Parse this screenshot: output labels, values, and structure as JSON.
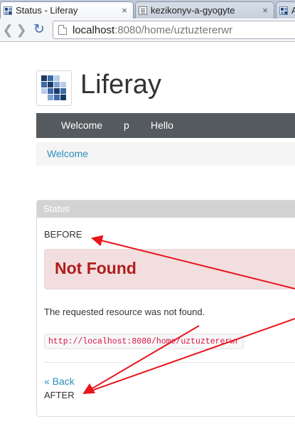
{
  "browser": {
    "tabs": [
      {
        "title": "Status - Liferay",
        "active": true
      },
      {
        "title": "kezikonyv-a-gyogyte",
        "active": false
      },
      {
        "title": "A",
        "active": false
      }
    ],
    "close_glyph": "×",
    "url_host": "localhost",
    "url_rest": ":8080/home/uztuztererwr"
  },
  "site": {
    "name": "Liferay",
    "logo_colors": [
      "#1b3a66",
      "#3d6aa8",
      "#7fa3d0",
      "#b9cde6"
    ]
  },
  "nav": {
    "items": [
      "Welcome",
      "p",
      "Hello"
    ]
  },
  "breadcrumb": {
    "items": [
      "Welcome"
    ]
  },
  "portlet": {
    "title": "Status",
    "before_label": "BEFORE",
    "error_heading": "Not Found",
    "message": "The requested resource was not found.",
    "requested_url": "http://localhost:8080/home/uztuztererwr",
    "back_link": "« Back",
    "after_label": "AFTER"
  },
  "annotation_color": "#e8141b"
}
